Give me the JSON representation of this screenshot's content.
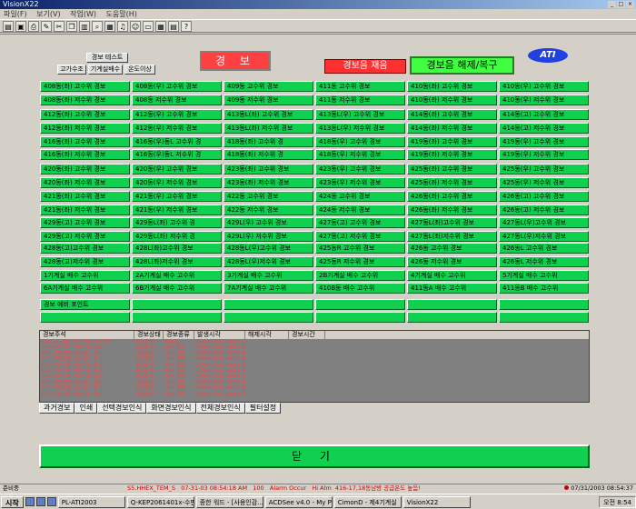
{
  "window": {
    "title": "VisionX22"
  },
  "menu": [
    "파일(F)",
    "보기(V)",
    "작업(W)",
    "도움말(H)"
  ],
  "toolbar_icons": [
    "open-icon",
    "save-icon",
    "print-icon",
    "edit-icon",
    "cut-icon",
    "copy-icon",
    "paste-icon",
    "find-icon",
    "chart-icon",
    "bell-icon",
    "user-icon",
    "monitor-icon",
    "grid-icon",
    "table-icon",
    "help-icon"
  ],
  "small_buttons": {
    "alarm_test": "경보 테스트",
    "high_level": "고가수조",
    "aircon_drain": "기계실배수",
    "temp_high": "온도이상"
  },
  "alarm_title": "경 보",
  "ack_label": "경보음 재음",
  "reset_label": "경보음 해제/복구",
  "logo": "ATI",
  "alarm_grid": [
    [
      "408동(좌) 고수위 경보",
      "408동(우) 고수위 경보",
      "409동 고수위 경보",
      "411동 고수위 경보",
      "410동(좌) 고수위 경보",
      "410동(우) 고수위 경보"
    ],
    [
      "408동(좌) 저수위 경보",
      "408동 저수위 경보",
      "409동 저수위 경보",
      "411동 저수위 경보",
      "410동(좌) 저수위 경보",
      "410동(우) 저수위 경보"
    ],
    [
      "412동(좌) 고수위 경보",
      "412동(우) 고수위 경보",
      "413동L(좌) 고수위 경보",
      "413동L(우) 고수위 경보",
      "414동(좌) 고수위 경보",
      "414동(고) 고수위 경보"
    ],
    [
      "412동(좌) 저수위 경보",
      "412동(우) 저수위 경보",
      "413동L(좌) 저수위 경보",
      "413동L(우) 저수위 경보",
      "414동(좌) 저수위 경보",
      "414동(고) 저수위 경보"
    ],
    [
      "416동(좌) 고수위 경보",
      "416동(우)동L 고수위 경",
      "418동(좌) 고수위 경",
      "418동(우) 고수위 경보",
      "419동(좌) 고수위 경보",
      "419동(우) 고수위 경보"
    ],
    [
      "416동(좌) 저수위 경보",
      "416동(우)동L 저수위 경",
      "418동(좌) 저수위 경",
      "418동(우) 저수위 경보",
      "419동(좌) 저수위 경보",
      "419동(우) 저수위 경보"
    ],
    [
      "420동(좌) 고수위 경보",
      "420동(우) 고수위 경보",
      "423동(좌) 고수위 경보",
      "423동(우) 고수위 경보",
      "425동(좌) 고수위 경보",
      "425동(우) 고수위 경보"
    ],
    [
      "420동(좌) 저수위 경보",
      "420동(우) 저수위 경보",
      "423동(좌) 저수위 경보",
      "423동(우) 저수위 경보",
      "425동(좌) 저수위 경보",
      "425동(우) 저수위 경보"
    ],
    [
      "421동(좌) 고수위 경보",
      "421동(우) 고수위 경보",
      "422동 고수위 경보",
      "424동 고수위 경보",
      "426동(좌) 고수위 경보",
      "426동(고) 고수위 경보"
    ],
    [
      "421동(좌) 저수위 경보",
      "421동(우) 저수위 경보",
      "422동 저수위 경보",
      "424동 저수위 경보",
      "426동(좌) 저수위 경보",
      "426동(고) 저수위 경보"
    ],
    [
      "429동(고) 고수위 경보",
      "429동L(좌) 고수위 경",
      "429L(우) 고수위 경보",
      "427동(고) 고수위 경보",
      "427동L(좌)고수위 경보",
      "427동L(우)고수위 경보"
    ],
    [
      "429동(고) 저수위 경보",
      "429동L(좌) 저수위 경",
      "429L(우) 저수위 경보",
      "427동(고) 저수위 경보",
      "427동L(좌)저수위 경보",
      "427동L(우)저수위 경보"
    ],
    [
      "428동(고)고수위 경보",
      "428L(좌)고수위 경보",
      "428동L(우)고수위 경보",
      "425동R 고수위 경보",
      "426동 고수위 경보",
      "426동L 고수위 경보"
    ],
    [
      "428동(고)저수위 경보",
      "428L(좌)저수위 경보",
      "428동L(우)저수위 경보",
      "425동R 저수위 경보",
      "426동 저수위 경보",
      "426동L 저수위 경보"
    ],
    [
      "1기계실 배수 고수위",
      "2A기계실 배수 고수위",
      "3기계실 배수 고수위",
      "2B기계실 배수 고수위",
      "4기계실 배수 고수위",
      "5기계실 배수 고수위"
    ],
    [
      "6A기계실 배수 고수위",
      "6B기계실 배수 고수위",
      "7A기계실 배수 고수위",
      "410B동 배수 고수위",
      "411동A 배수 고수위",
      "411동B 배수 고수위"
    ],
    [
      "경보 예비 포인트",
      "",
      "",
      "",
      "",
      ""
    ],
    [
      "",
      "",
      "",
      "",
      "",
      ""
    ]
  ],
  "event_columns": [
    "경보주석",
    "경보상태",
    "경보종류",
    "발생시각",
    "해제시각",
    "경보시간"
  ],
  "event_rows": [
    [
      "416-17,18동남방 공급온도 높음!",
      "경보발생",
      "HI경보",
      "2003/07/31 08:54:18",
      "",
      ""
    ],
    [
      "401~5동남방 공급온도 높음!",
      "경보발생",
      "HiHi 경보",
      "2003/07/31 08:53:44",
      "",
      ""
    ],
    [
      "401~7동남방 공급온도 경고!",
      "경보발생",
      "HiHi 경보",
      "2003/07/31 08:53:44",
      "",
      ""
    ],
    [
      "401~7동남방 공급온도 경고!",
      "경보발생",
      "HiHi 경보",
      "2003/07/31 08:53:43",
      "",
      ""
    ],
    [
      "401~7동남방 공급온도 경고!",
      "경보발생",
      "HiHi 경보",
      "2003/07/31 08:53:43",
      "",
      ""
    ],
    [
      "401~7동남방 공급온도 경고!",
      "경보발생",
      "HiHi 경보",
      "2003/07/31 08:53:43",
      "",
      ""
    ],
    [
      "401~5동남방 공급온도 높음!",
      "경보발생",
      "HiHi 경보",
      "2003/07/31 08:53:43",
      "",
      ""
    ],
    [
      "401~5동남방 공급온도 높음!",
      "경보발생",
      "HiHi 경보",
      "2003/07/31 08:53:43",
      "",
      ""
    ],
    [
      "401~7동남방 공급온도 경고!",
      "경보발생",
      "HiHi 경보",
      "2003/07/31 08:53:43",
      "",
      ""
    ],
    [
      "401~7동남방 공급온도 경고!",
      "경보발생",
      "HiHi 경보",
      "2003/07/31 08:53:43",
      "",
      ""
    ]
  ],
  "event_tabs": [
    "과거경보",
    "인쇄",
    "선택경보인식",
    "화면경보인식",
    "전체경보인식",
    "필터설정"
  ],
  "close_label": "닫 기",
  "status": {
    "ready": "준비중",
    "alarm_tag": "S5.HHEX_TEM_S",
    "alarm_time": "07-31-03 08:54:18 AM",
    "alarm_code": "100",
    "alarm_type": "Alarm Occur",
    "alarm_level": "Hi Alm",
    "alarm_msg": "416-17,18동남방 공급온도 높음!",
    "clock": "07/31/2003 08:54:37"
  },
  "taskbar": {
    "start": "시작",
    "tasks": [
      "PL-ATI2003",
      "Q-KEP2061401x-수만...",
      "종한 워드 - [사용인감...",
      "ACDSee v4.0 - My Pi...",
      "CimonD - 제4기계실",
      "VisionX22"
    ],
    "clock": "오전 8:54"
  },
  "colors": {
    "green": "#10d050",
    "red": "#ff3030",
    "bright_green": "#40ff40",
    "logo_blue": "#2040e0"
  }
}
